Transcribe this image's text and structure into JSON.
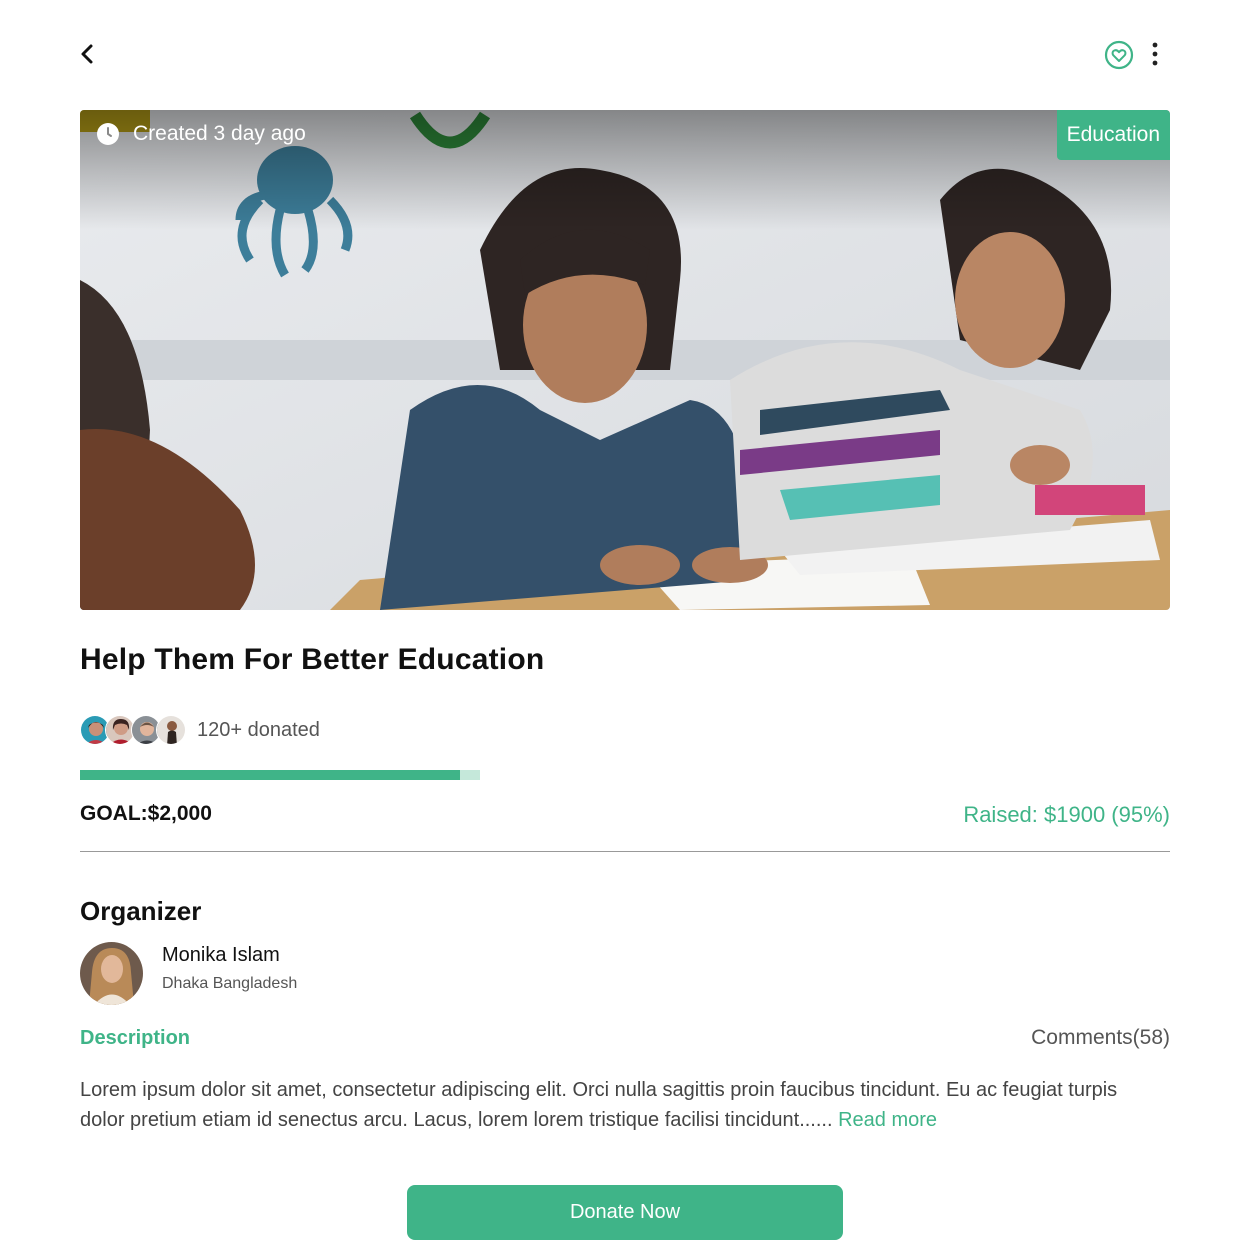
{
  "header": {
    "back_icon": "chevron-left-icon",
    "favorite_icon": "heart-circle-icon",
    "more_icon": "vertical-dots-icon"
  },
  "hero": {
    "image": "children-studying-photo",
    "created_label": "Created 3 day ago",
    "clock_icon": "clock-icon",
    "category": "Education"
  },
  "campaign": {
    "title": "Help Them For Better Education",
    "donors_label": "120+ donated",
    "progress_fraction": 0.95,
    "goal_label": "GOAL:$2,000",
    "raised_label": "Raised: $1900 (95%)"
  },
  "organizer": {
    "heading": "Organizer",
    "name": "Monika Islam",
    "location": "Dhaka Bangladesh"
  },
  "tabs": {
    "description": "Description",
    "comments": "Comments(58)"
  },
  "description": {
    "text": "Lorem ipsum dolor sit amet, consectetur adipiscing elit. Orci nulla sagittis proin faucibus tincidunt. Eu ac feugiat turpis dolor pretium etiam id senectus arcu. Lacus, lorem lorem tristique facilisi tincidunt...... ",
    "read_more": "Read more"
  },
  "actions": {
    "donate": "Donate Now"
  },
  "colors": {
    "accent": "#3fb488",
    "accent_light": "#c5e8da"
  }
}
